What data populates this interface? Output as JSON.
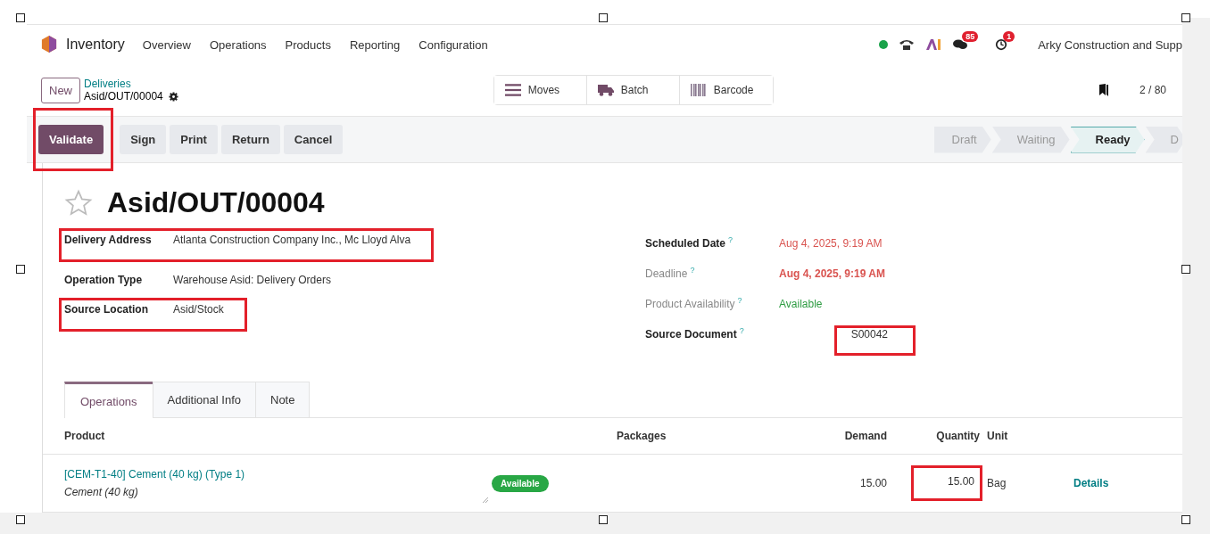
{
  "navbar": {
    "app_name": "Inventory",
    "menu": [
      "Overview",
      "Operations",
      "Products",
      "Reporting",
      "Configuration"
    ],
    "online": true,
    "chat_count": "85",
    "activity_count": "1",
    "company": "Arky Construction and Supp"
  },
  "breadcrumb": {
    "parent": "Deliveries",
    "current": "Asid/OUT/00004"
  },
  "new_button": "New",
  "smart_buttons": [
    "Moves",
    "Batch",
    "Barcode"
  ],
  "pager": "2 / 80",
  "actions": [
    {
      "label": "Validate",
      "primary": true,
      "highlighted": true
    },
    {
      "label": "Sign",
      "primary": false,
      "highlighted": false
    },
    {
      "label": "Print",
      "primary": false,
      "highlighted": false
    },
    {
      "label": "Return",
      "primary": false,
      "highlighted": false
    },
    {
      "label": "Cancel",
      "primary": false,
      "highlighted": false
    }
  ],
  "stages": [
    {
      "label": "Draft",
      "selected": false
    },
    {
      "label": "Waiting",
      "selected": false
    },
    {
      "label": "Ready",
      "selected": true
    },
    {
      "label": "D",
      "selected": false
    }
  ],
  "record": {
    "title": "Asid/OUT/00004",
    "starred": false
  },
  "left_fields": [
    {
      "label": "Delivery Address",
      "value": "Atlanta Construction Company Inc., Mc Lloyd Alva",
      "highlighted": true
    },
    {
      "label": "Operation Type",
      "value": "Warehouse Asid: Delivery Orders",
      "highlighted": false
    },
    {
      "label": "Source Location",
      "value": "Asid/Stock",
      "highlighted": true
    }
  ],
  "right_fields": [
    {
      "label": "Scheduled Date",
      "help": "?",
      "value": "Aug 4, 2025, 9:19 AM",
      "color": "#d9534f",
      "label_muted": false,
      "value_bold": false,
      "highlighted": false
    },
    {
      "label": "Deadline",
      "help": "?",
      "value": "Aug 4, 2025, 9:19 AM",
      "color": "#d9534f",
      "label_muted": true,
      "value_bold": true,
      "highlighted": false
    },
    {
      "label": "Product Availability",
      "help": "?",
      "value": "Available",
      "color": "#2e9c42",
      "label_muted": true,
      "value_bold": false,
      "highlighted": false
    },
    {
      "label": "Source Document",
      "help": "?",
      "value": "S00042",
      "color": "#333333",
      "label_muted": false,
      "value_bold": false,
      "highlighted": true
    }
  ],
  "tabs": [
    {
      "label": "Operations",
      "selected": true
    },
    {
      "label": "Additional Info",
      "selected": false
    },
    {
      "label": "Note",
      "selected": false
    }
  ],
  "table": {
    "columns": [
      "Product",
      "Packages",
      "Demand",
      "Quantity",
      "Unit"
    ],
    "rows": [
      {
        "product": "[CEM-T1-40] Cement (40 kg) (Type 1)",
        "description": "Cement (40 kg)",
        "availability": "Available",
        "demand": "15.00",
        "quantity": "15.00",
        "quantity_highlighted": true,
        "unit": "Bag",
        "action": "Details"
      }
    ]
  }
}
